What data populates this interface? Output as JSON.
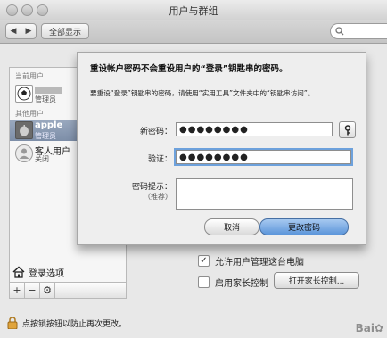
{
  "window": {
    "title": "用户与群组"
  },
  "toolbar": {
    "back": "◀",
    "forward": "▶",
    "show_all": "全部显示"
  },
  "sidebar": {
    "current_user_header": "当前用户",
    "current_user_role": "管理员",
    "other_users_header": "其他用户",
    "users": [
      {
        "name": "apple",
        "role": "管理员"
      },
      {
        "name": "客人用户",
        "role": "关闭"
      }
    ],
    "login_options": "登录选项",
    "add_btn": "+",
    "remove_btn": "−",
    "gear_btn": "⚙"
  },
  "dialog": {
    "heading": "重设帐户密码不会重设用户的“登录”钥匙串的密码。",
    "description": "要重设“登录”钥匙串的密码，请使用“实用工具”文件夹中的“钥匙串访问”。",
    "new_password_label": "新密码：",
    "new_password_value": "●●●●●●●●",
    "verify_label": "验证：",
    "verify_value": "●●●●●●●●",
    "hint_label": "密码提示：",
    "hint_sublabel": "（推荐）",
    "cancel": "取消",
    "confirm": "更改密码"
  },
  "panel": {
    "allow_admin": "允许用户管理这台电脑",
    "allow_admin_checked": true,
    "parental": "启用家长控制",
    "parental_checked": false,
    "open_parental": "打开家长控制..."
  },
  "footer": {
    "lock_text": "点按锁按钮以防止再次更改。"
  },
  "watermark": "Baidu"
}
